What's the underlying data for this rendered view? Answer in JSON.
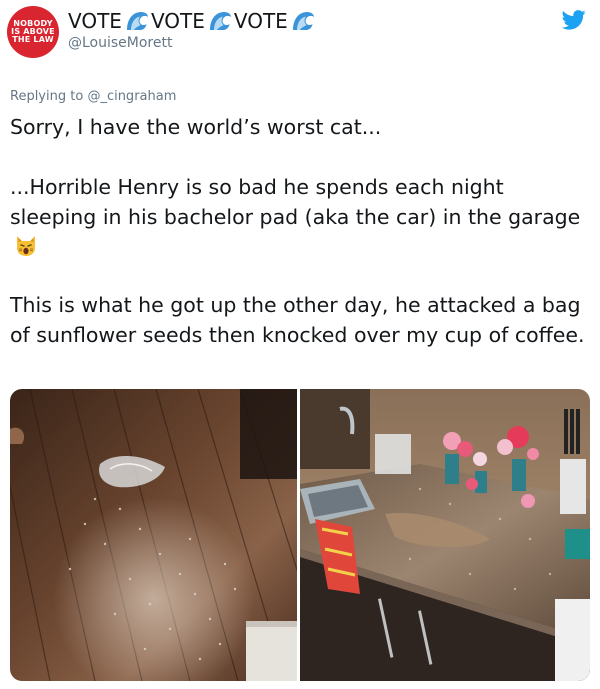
{
  "tweet": {
    "avatar": {
      "lines": [
        "NOBODY",
        "IS ABOVE",
        "THE LAW"
      ],
      "color": "#d9252f"
    },
    "display_name_parts": [
      "VOTE",
      "VOTE",
      "VOTE"
    ],
    "name_emoji": "water-wave-icon",
    "handle": "@LouiseMorett",
    "brand_icon": "twitter-bird-icon",
    "brand_color": "#1da1f2",
    "replying_prefix": "Replying to",
    "replying_to": "@_cingraham",
    "paragraph_1": "Sorry, I have the world’s worst cat...",
    "paragraph_2": "...Horrible Henry is so bad he spends each night sleeping in his bachelor pad (aka the car) in the garage",
    "paragraph_2_emoji": "weary-cat-face-icon",
    "paragraph_3": "This is what he got up the other day, he attacked a bag of sunflower seeds then knocked over my cup of coffee.",
    "photos": [
      {
        "subject": "wood floor with scattered sunflower seeds and plastic bag"
      },
      {
        "subject": "kitchen counter with spilled coffee, flowers and sink"
      }
    ]
  }
}
